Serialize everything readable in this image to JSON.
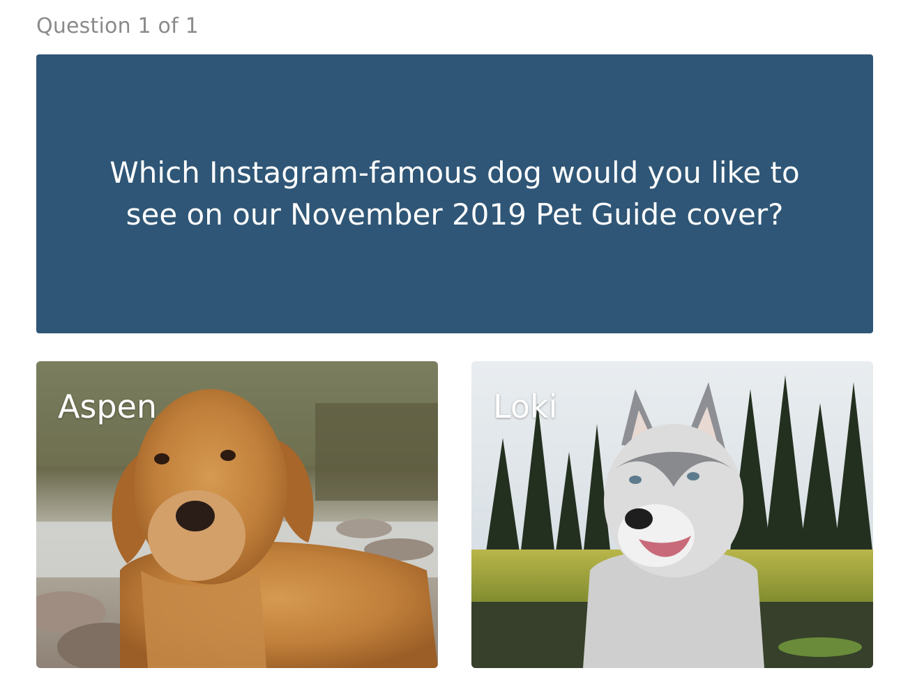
{
  "survey": {
    "counter": "Question 1 of 1",
    "question": "Which Instagram-famous dog would you like to see on our November 2019 Pet Guide cover?",
    "question_bg": "#2f5676"
  },
  "options": [
    {
      "label": "Aspen",
      "image": "golden-retriever-photo"
    },
    {
      "label": "Loki",
      "image": "husky-photo"
    }
  ]
}
